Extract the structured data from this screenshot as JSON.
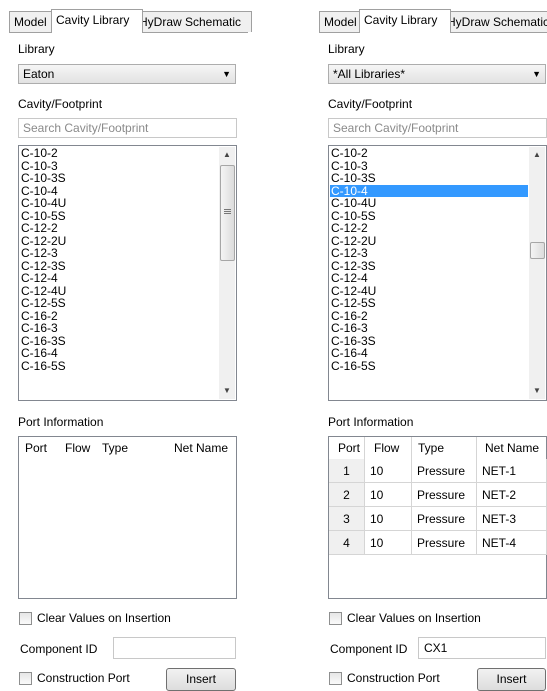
{
  "tabs": [
    "Model",
    "Cavity Library",
    "HyDraw Schematic"
  ],
  "labels": {
    "library": "Library",
    "cavity_footprint": "Cavity/Footprint",
    "port_information": "Port Information",
    "component_id": "Component ID"
  },
  "left": {
    "library_value": "Eaton",
    "search_placeholder": "Search Cavity/Footprint",
    "cavities": [
      "C-10-2",
      "C-10-3",
      "C-10-3S",
      "C-10-4",
      "C-10-4U",
      "C-10-5S",
      "C-12-2",
      "C-12-2U",
      "C-12-3",
      "C-12-3S",
      "C-12-4",
      "C-12-4U",
      "C-12-5S",
      "C-16-2",
      "C-16-3",
      "C-16-3S",
      "C-16-4",
      "C-16-5S"
    ],
    "ports_headers": [
      "Port",
      "Flow",
      "Type",
      "Net Name"
    ],
    "component_id": ""
  },
  "right": {
    "library_value": "*All Libraries*",
    "search_placeholder": "Search Cavity/Footprint",
    "cavities": [
      "C-10-2",
      "C-10-3",
      "C-10-3S",
      "C-10-4",
      "C-10-4U",
      "C-10-5S",
      "C-12-2",
      "C-12-2U",
      "C-12-3",
      "C-12-3S",
      "C-12-4",
      "C-12-4U",
      "C-12-5S",
      "C-16-2",
      "C-16-3",
      "C-16-3S",
      "C-16-4",
      "C-16-5S"
    ],
    "selected_cavity": "C-10-4",
    "ports_headers": [
      "Port",
      "Flow",
      "Type",
      "Net Name"
    ],
    "ports": [
      {
        "port": "1",
        "flow": "10",
        "type": "Pressure",
        "net": "NET-1"
      },
      {
        "port": "2",
        "flow": "10",
        "type": "Pressure",
        "net": "NET-2"
      },
      {
        "port": "3",
        "flow": "10",
        "type": "Pressure",
        "net": "NET-3"
      },
      {
        "port": "4",
        "flow": "10",
        "type": "Pressure",
        "net": "NET-4"
      }
    ],
    "component_id": "CX1"
  },
  "checkboxes": {
    "clear_values": "Clear Values on Insertion",
    "construction_port": "Construction Port"
  },
  "buttons": {
    "insert": "Insert"
  },
  "colors": {
    "selection": "#3399ff"
  }
}
